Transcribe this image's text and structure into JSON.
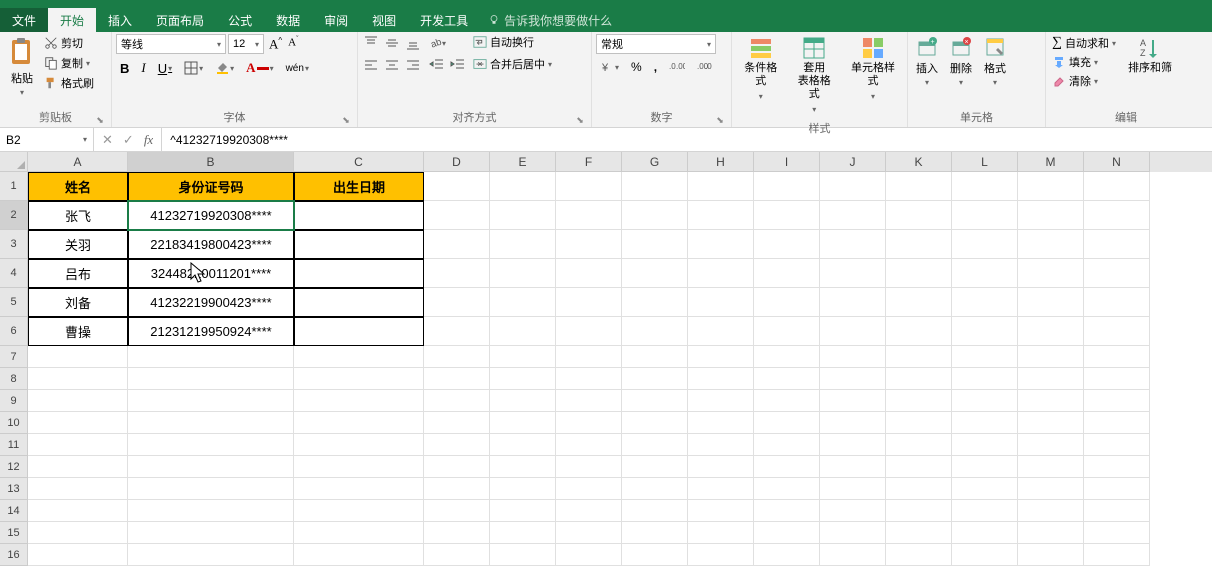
{
  "menu": {
    "file": "文件",
    "home": "开始",
    "insert": "插入",
    "page_layout": "页面布局",
    "formulas": "公式",
    "data": "数据",
    "review": "审阅",
    "view": "视图",
    "developer": "开发工具",
    "tell_me": "告诉我你想要做什么"
  },
  "ribbon": {
    "clipboard": {
      "label": "剪贴板",
      "paste": "粘贴",
      "cut": "剪切",
      "copy": "复制",
      "format_painter": "格式刷"
    },
    "font": {
      "label": "字体",
      "name": "等线",
      "size": "12",
      "wen": "wén"
    },
    "alignment": {
      "label": "对齐方式",
      "wrap": "自动换行",
      "merge": "合并后居中"
    },
    "number": {
      "label": "数字",
      "format": "常规"
    },
    "styles": {
      "label": "样式",
      "cond": "条件格式",
      "table": "套用\n表格格式",
      "cell": "单元格样式"
    },
    "cells": {
      "label": "单元格",
      "insert": "插入",
      "delete": "删除",
      "format": "格式"
    },
    "editing": {
      "label": "编辑",
      "sum": "自动求和",
      "fill": "填充",
      "clear": "清除",
      "sort": "排序和筛"
    }
  },
  "fx": {
    "name_box": "B2",
    "formula": "^41232719920308****"
  },
  "cols": [
    "A",
    "B",
    "C",
    "D",
    "E",
    "F",
    "G",
    "H",
    "I",
    "J",
    "K",
    "L",
    "M",
    "N"
  ],
  "row_nums": [
    "1",
    "2",
    "3",
    "4",
    "5",
    "6",
    "7",
    "8",
    "9",
    "10",
    "11",
    "12",
    "13",
    "14",
    "15",
    "16"
  ],
  "table": {
    "headers": {
      "a": "姓名",
      "b": "身份证号码",
      "c": "出生日期"
    },
    "rows": [
      {
        "a": "张飞",
        "b": "41232719920308****",
        "c": ""
      },
      {
        "a": "关羽",
        "b": "22183419800423****",
        "c": ""
      },
      {
        "a": "吕布",
        "b": "32448220011201****",
        "c": ""
      },
      {
        "a": "刘备",
        "b": "41232219900423****",
        "c": ""
      },
      {
        "a": "曹操",
        "b": "21231219950924****",
        "c": ""
      }
    ]
  }
}
